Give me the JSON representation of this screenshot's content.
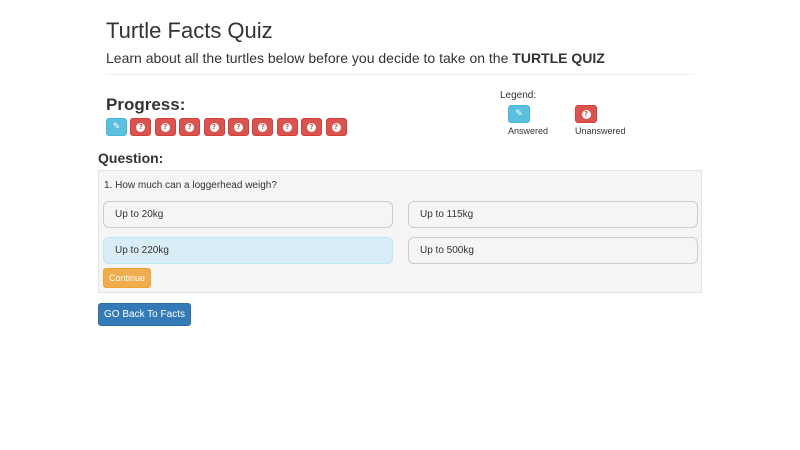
{
  "header": {
    "title": "Turtle Facts Quiz",
    "subtitle_prefix": "Learn about all the turtles below before you decide to take on the ",
    "subtitle_bold": "TURTLE QUIZ"
  },
  "progress": {
    "title": "Progress:",
    "items": [
      {
        "state": "answered",
        "icon": "pencil-icon"
      },
      {
        "state": "unanswered",
        "icon": "question-icon"
      },
      {
        "state": "unanswered",
        "icon": "question-icon"
      },
      {
        "state": "unanswered",
        "icon": "question-icon"
      },
      {
        "state": "unanswered",
        "icon": "question-icon"
      },
      {
        "state": "unanswered",
        "icon": "question-icon"
      },
      {
        "state": "unanswered",
        "icon": "question-icon"
      },
      {
        "state": "unanswered",
        "icon": "question-icon"
      },
      {
        "state": "unanswered",
        "icon": "question-icon"
      },
      {
        "state": "unanswered",
        "icon": "question-icon"
      }
    ]
  },
  "legend": {
    "label": "Legend:",
    "answered_label": "Answered",
    "unanswered_label": "Unanswered"
  },
  "question": {
    "heading": "Question:",
    "text": "1. How much can a loggerhead weigh?",
    "answers": [
      {
        "label": "Up to 20kg",
        "selected": false
      },
      {
        "label": "Up to 115kg",
        "selected": false
      },
      {
        "label": "Up to 220kg",
        "selected": true
      },
      {
        "label": "Up to 500kg",
        "selected": false
      }
    ],
    "continue_label": "Continue"
  },
  "footer": {
    "back_label": "GO Back To Facts"
  },
  "colors": {
    "answered": "#5bc0de",
    "unanswered": "#d9534f",
    "selected_answer": "#d9edf7",
    "continue": "#f0ad4e",
    "back_button": "#337ab7"
  }
}
